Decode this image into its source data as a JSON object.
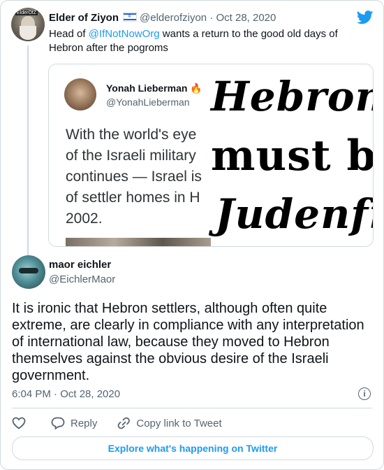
{
  "parent_tweet": {
    "author_name": "Elder of Ziyon",
    "flag_icon": "israel-flag-icon",
    "handle": "@elderofziyon",
    "date": "Oct 28, 2020",
    "separator": "·",
    "text_prefix": "Head of ",
    "mention": "@IfNotNowOrg",
    "text_suffix": " wants a return to the good old days of Hebron after the pogroms",
    "avatar_label": "ElderOfZ",
    "brand_icon": "twitter-bird-icon",
    "brand_color": "#1d9bf0"
  },
  "quoted_image": {
    "author_name": "Yonah Lieberman",
    "author_emoji": "🔥",
    "handle": "@YonahLieberman",
    "body_lines": [
      "With the world's eye",
      "of the Israeli military",
      "continues — Israel is",
      "of settler homes in H",
      "2002."
    ],
    "overlay_lines": [
      "Hebron",
      "must be",
      "Judenfre"
    ]
  },
  "reply_tweet": {
    "author_name": "maor eichler",
    "handle": "@EichlerMaor",
    "text": "It is ironic that Hebron settlers, although often quite extreme, are clearly in compliance with any interpretation of international law, because they moved to Hebron themselves against the obvious desire of the Israeli government.",
    "timestamp": "6:04 PM · Oct 28, 2020",
    "info_icon": "info-icon"
  },
  "actions": {
    "like_icon": "heart-icon",
    "reply_icon": "reply-icon",
    "reply_label": "Reply",
    "copy_icon": "link-icon",
    "copy_label": "Copy link to Tweet"
  },
  "footer": {
    "explore_label": "Explore what's happening on Twitter"
  }
}
